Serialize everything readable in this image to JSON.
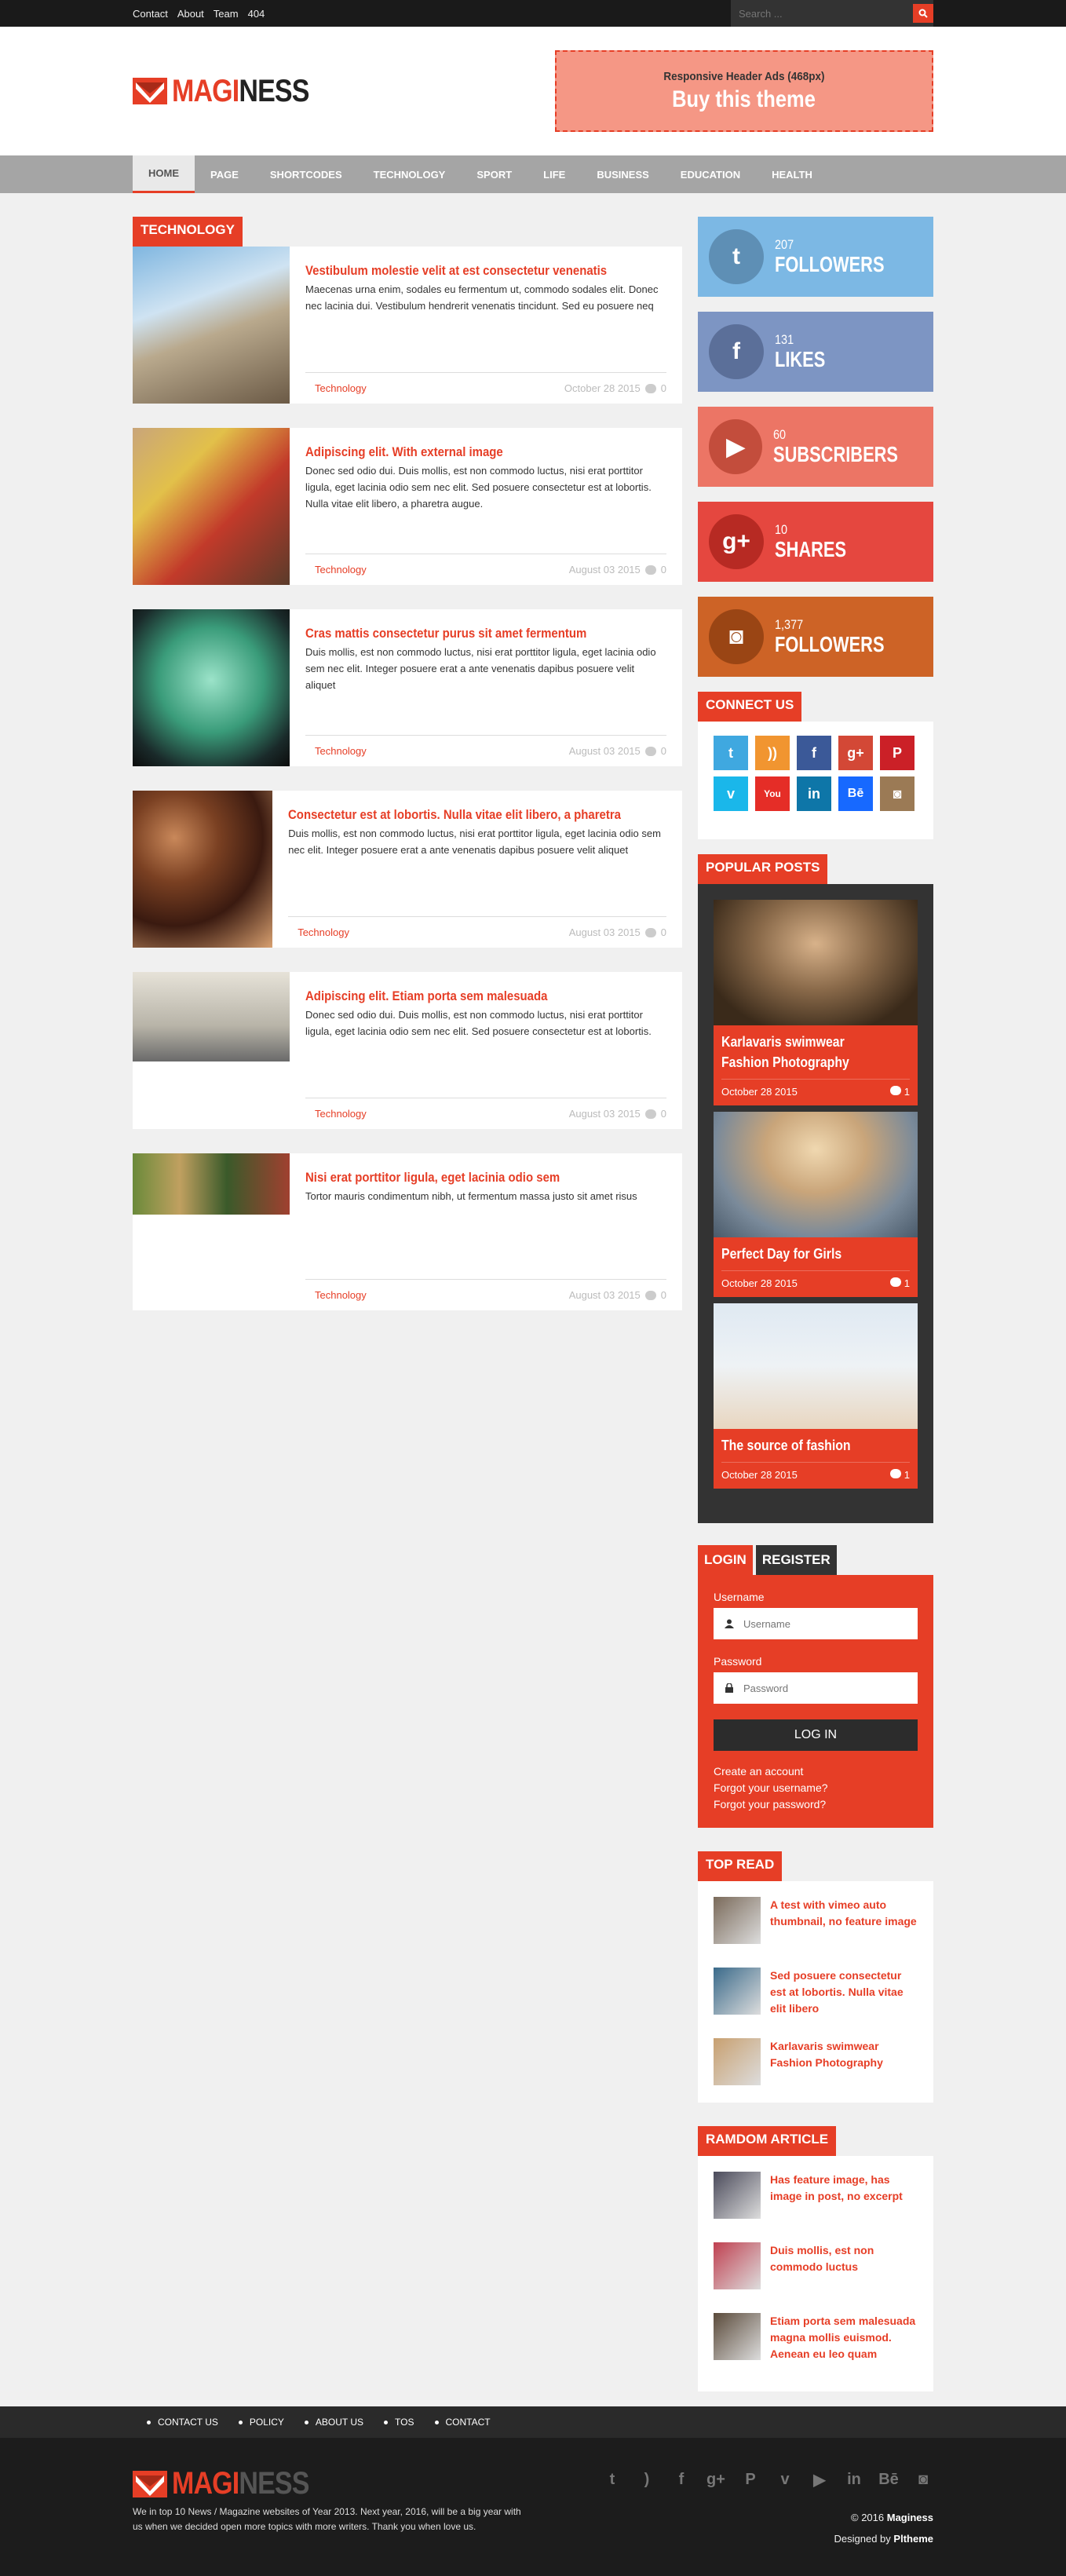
{
  "topbar": {
    "links": [
      "Contact",
      "About",
      "Team",
      "404"
    ],
    "search_placeholder": "Search ..."
  },
  "header": {
    "logo_part1": "MAGI",
    "logo_part2": "NESS",
    "ad_line1": "Responsive Header Ads (468px)",
    "ad_line2": "Buy this theme"
  },
  "nav": {
    "items": [
      "HOME",
      "PAGE",
      "SHORTCODES",
      "TECHNOLOGY",
      "SPORT",
      "LIFE",
      "BUSINESS",
      "EDUCATION",
      "HEALTH"
    ],
    "active": "HOME"
  },
  "content": {
    "category_title": "TECHNOLOGY",
    "posts": [
      {
        "title": "Vestibulum molestie velit at est consectetur venenatis",
        "excerpt": "Maecenas urna enim, sodales eu fermentum ut, commodo sodales elit. Donec nec lacinia dui. Vestibulum hendrerit venenatis tincidunt. Sed eu posuere neq",
        "category": "Technology",
        "date": "October 28 2015",
        "comments": "0"
      },
      {
        "title": "Adipiscing elit. With external image",
        "excerpt": "Donec sed odio dui. Duis mollis, est non commodo luctus, nisi erat porttitor ligula, eget lacinia odio sem nec elit. Sed posuere consectetur est at lobortis. Nulla vitae elit libero, a pharetra augue.",
        "category": "Technology",
        "date": "August 03 2015",
        "comments": "0"
      },
      {
        "title": "Cras mattis consectetur purus sit amet fermentum",
        "excerpt": "Duis mollis, est non commodo luctus, nisi erat porttitor ligula, eget lacinia odio sem nec elit. Integer posuere erat a ante venenatis dapibus posuere velit aliquet",
        "category": "Technology",
        "date": "August 03 2015",
        "comments": "0"
      },
      {
        "title": "Consectetur est at lobortis. Nulla vitae elit libero, a pharetra",
        "excerpt": "Duis mollis, est non commodo luctus, nisi erat porttitor ligula, eget lacinia odio sem nec elit. Integer posuere erat a ante venenatis dapibus posuere velit aliquet",
        "category": "Technology",
        "date": "August 03 2015",
        "comments": "0"
      },
      {
        "title": "Adipiscing elit. Etiam porta sem malesuada",
        "excerpt": "Donec sed odio dui. Duis mollis, est non commodo luctus, nisi erat porttitor ligula, eget lacinia odio sem nec elit. Sed posuere consectetur est at lobortis.",
        "category": "Technology",
        "date": "August 03 2015",
        "comments": "0"
      },
      {
        "title": "Nisi erat porttitor ligula, eget lacinia odio sem",
        "excerpt": "Tortor mauris condimentum nibh, ut fermentum massa justo sit amet risus",
        "category": "Technology",
        "date": "August 03 2015",
        "comments": "0"
      }
    ]
  },
  "sidebar": {
    "counters": [
      {
        "count": "207",
        "label": "FOLLOWERS",
        "icon": "twitter-icon",
        "bg": "#7cb8e4",
        "circ": "#5e8fb5"
      },
      {
        "count": "131",
        "label": "LIKES",
        "icon": "facebook-icon",
        "bg": "#7d95c3",
        "circ": "#5b6f99"
      },
      {
        "count": "60",
        "label": "SUBSCRIBERS",
        "icon": "youtube-icon",
        "bg": "#ec7565",
        "circ": "#c34d3c"
      },
      {
        "count": "10",
        "label": "SHARES",
        "icon": "google-plus-icon",
        "bg": "#e5473f",
        "circ": "#b72a23"
      },
      {
        "count": "1,377",
        "label": "FOLLOWERS",
        "icon": "instagram-icon",
        "bg": "#cd6326",
        "circ": "#9a4514"
      }
    ],
    "connect_title": "CONNECT US",
    "popular_title": "POPULAR POSTS",
    "popular": [
      {
        "title": "Karlavaris swimwear Fashion Photography",
        "date": "October 28 2015",
        "comments": "1"
      },
      {
        "title": "Perfect Day for Girls",
        "date": "October 28 2015",
        "comments": "1"
      },
      {
        "title": "The source of fashion",
        "date": "October 28 2015",
        "comments": "1"
      }
    ],
    "login": {
      "tab_login": "LOGIN",
      "tab_register": "REGISTER",
      "username_label": "Username",
      "username_placeholder": "Username",
      "password_label": "Password",
      "password_placeholder": "Password",
      "button": "LOG IN",
      "links": [
        "Create an account",
        "Forgot your username?",
        "Forgot your password?"
      ]
    },
    "top_read_title": "TOP READ",
    "top_read": [
      "A test with vimeo auto thumbnail, no feature image",
      "Sed posuere consectetur est at lobortis. Nulla vitae elit libero",
      "Karlavaris swimwear Fashion Photography"
    ],
    "random_title": "RAMDOM ARTICLE",
    "random": [
      "Has feature image, has image in post, no excerpt",
      "Duis mollis, est non commodo luctus",
      "Etiam porta sem malesuada magna mollis euismod. Aenean eu leo quam"
    ]
  },
  "footer": {
    "nav": [
      "CONTACT US",
      "POLICY",
      "ABOUT US",
      "TOS",
      "CONTACT"
    ],
    "desc": "We in top 10 News / Magazine websites of Year 2013. Next year, 2016, will be a big year with us when we decided open more topics with more writers. Thank you when love us.",
    "copyright_prefix": "© 2016",
    "copyright_name": "Maginess",
    "designed_prefix": "Designed by",
    "designed_name": "Pltheme"
  },
  "colors": {
    "accent": "#e63e26",
    "nav": "#a5a5a5",
    "dark": "#1a1a1a"
  }
}
